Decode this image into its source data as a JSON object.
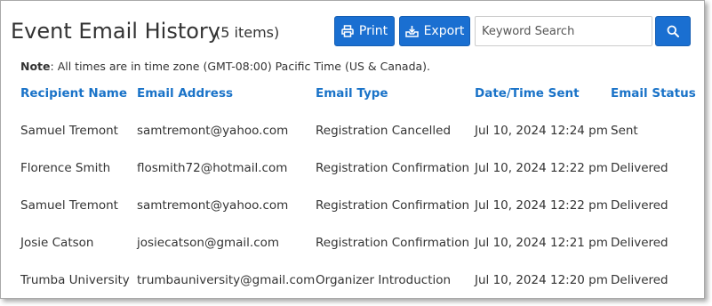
{
  "header": {
    "title": "Event Email History",
    "count": "(5 items)"
  },
  "toolbar": {
    "print_label": "Print",
    "export_label": "Export",
    "search_placeholder": "Keyword Search"
  },
  "note": {
    "label": "Note",
    "text": ": All times are in time zone (GMT-08:00) Pacific Time (US & Canada)."
  },
  "table": {
    "columns": [
      "Recipient Name",
      "Email Address",
      "Email Type",
      "Date/Time Sent",
      "Email Status"
    ],
    "rows": [
      [
        "Samuel Tremont",
        "samtremont@yahoo.com",
        "Registration Cancelled",
        "Jul 10, 2024 12:24 pm",
        "Sent"
      ],
      [
        "Florence Smith",
        "flosmith72@hotmail.com",
        "Registration Confirmation",
        "Jul 10, 2024 12:22 pm",
        "Delivered"
      ],
      [
        "Samuel Tremont",
        "samtremont@yahoo.com",
        "Registration Confirmation",
        "Jul 10, 2024 12:22 pm",
        "Delivered"
      ],
      [
        "Josie Catson",
        "josiecatson@gmail.com",
        "Registration Confirmation",
        "Jul 10, 2024 12:21 pm",
        "Delivered"
      ],
      [
        "Trumba University",
        "trumbauniversity@gmail.com",
        "Organizer Introduction",
        "Jul 10, 2024 12:20 pm",
        "Delivered"
      ]
    ]
  },
  "colors": {
    "accent": "#1a6fd1",
    "header_text": "#1a73c8",
    "body_text": "#333333"
  },
  "icons": {
    "print": "printer-icon",
    "export": "download-tray-icon",
    "search": "magnifier-icon"
  }
}
